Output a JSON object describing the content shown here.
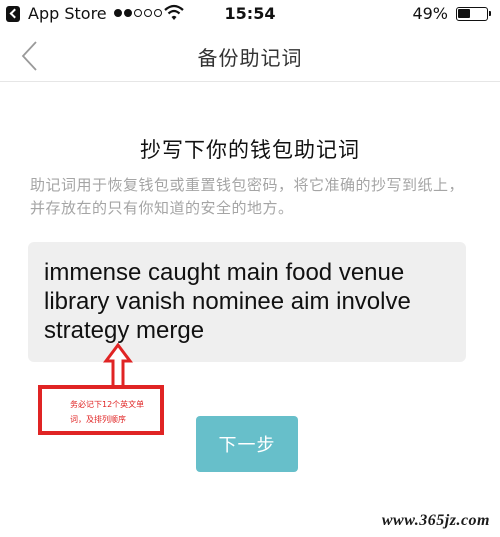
{
  "status_bar": {
    "carrier": "App Store",
    "signal_dots_filled": 2,
    "signal_dots_total": 5,
    "time": "15:54",
    "battery_percent": "49%",
    "battery_level": 0.49
  },
  "nav": {
    "title": "备份助记词",
    "back_icon": "chevron-left-icon"
  },
  "content": {
    "heading": "抄写下你的钱包助记词",
    "description": "助记词用于恢复钱包或重置钱包密码，将它准确的抄写到纸上，并存放在的只有你知道的安全的地方。",
    "mnemonic": "immense caught main food venue library vanish nominee aim involve strategy merge"
  },
  "annotation": {
    "text": "务必记下12个英文单词，及排列顺序",
    "color": "#e02424"
  },
  "actions": {
    "next_label": "下一步",
    "next_color": "#67bfca"
  },
  "watermark": {
    "text": "www.365jz.com"
  }
}
